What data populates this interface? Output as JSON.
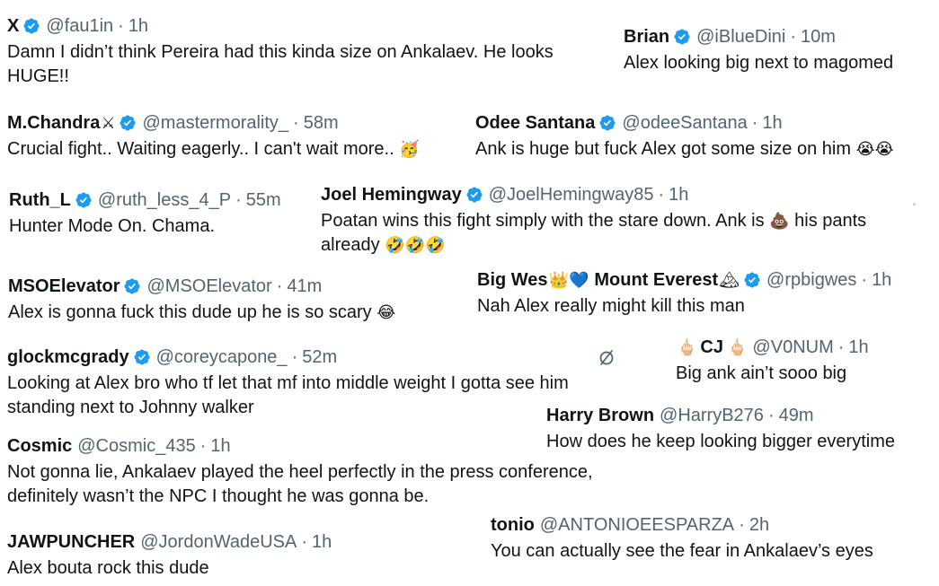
{
  "colors": {
    "verified": "#1d9bf0",
    "text": "#0f1419",
    "secondary": "#536471"
  },
  "separator": "·",
  "tweets": [
    {
      "name": "X",
      "handle": "@fau1in",
      "time": "1h",
      "verified": true,
      "text": "Damn I didn’t think Pereira had this kinda size on Ankalaev. He looks HUGE!!"
    },
    {
      "name": "Brian",
      "handle": "@iBlueDini",
      "time": "10m",
      "verified": true,
      "text": "Alex looking big next to magomed"
    },
    {
      "name": "M.Chandra",
      "name_emoji": "⚔",
      "handle": "@mastermorality_",
      "time": "58m",
      "verified": true,
      "text": "Crucial fight.. Waiting eagerly.. I can't wait more..",
      "text_emoji": "🥳"
    },
    {
      "name": "Odee Santana",
      "handle": "@odeeSantana",
      "time": "1h",
      "verified": true,
      "text": "Ank is huge but fuck Alex got some size on him",
      "text_emoji": "😭😭"
    },
    {
      "name": "Ruth_L",
      "handle": "@ruth_less_4_P",
      "time": "55m",
      "verified": true,
      "text": "Hunter Mode On. Chama."
    },
    {
      "name": "Joel Hemingway",
      "handle": "@JoelHemingway85",
      "time": "1h",
      "verified": true,
      "text": "Poatan wins this fight simply with the stare down. Ank is",
      "text_emoji": "💩",
      "text_after": "his pants",
      "text_line2": "already",
      "text_line2_emoji": "🤣🤣🤣"
    },
    {
      "name": "MSOElevator",
      "handle": "@MSOElevator",
      "time": "41m",
      "verified": true,
      "text": "Alex is gonna fuck this dude up he is so scary",
      "text_emoji": "😂"
    },
    {
      "name": "Big Wes",
      "name_emoji": "👑💙",
      "name2": "Mount Everest",
      "name2_emoji": "🏔",
      "handle": "@rpbigwes",
      "time": "1h",
      "verified": true,
      "text": "Nah Alex really might kill this man"
    },
    {
      "name": "glockmcgrady",
      "handle": "@coreycapone_",
      "time": "52m",
      "verified": true,
      "text": "Looking at Alex bro who tf let that mf into middle weight I gotta see him",
      "text_line2": "standing next to Johnny walker"
    },
    {
      "name": "CJ",
      "name_emoji_before": "🖕🏻",
      "name_emoji": "🖕🏻",
      "handle": "@V0NUM",
      "time": "1h",
      "verified": false,
      "text": "Big ank ain’t sooo big"
    },
    {
      "name": "Harry Brown",
      "handle": "@HarryB276",
      "time": "49m",
      "verified": false,
      "text": "How does he keep looking bigger everytime"
    },
    {
      "name": "Cosmic",
      "handle": "@Cosmic_435",
      "time": "1h",
      "verified": false,
      "text": "Not gonna lie, Ankalaev played the heel perfectly in the press conference,",
      "text_line2": "definitely wasn’t the NPC I thought he was gonna be."
    },
    {
      "name": "tonio",
      "handle": "@ANTONIOEESPARZA",
      "time": "2h",
      "verified": false,
      "text": "You can actually see the fear in Ankalaev’s eyes"
    },
    {
      "name": "JAWPUNCHER",
      "handle": "@JordonWadeUSA",
      "time": "1h",
      "verified": false,
      "text": "Alex bouta rock this dude"
    }
  ]
}
